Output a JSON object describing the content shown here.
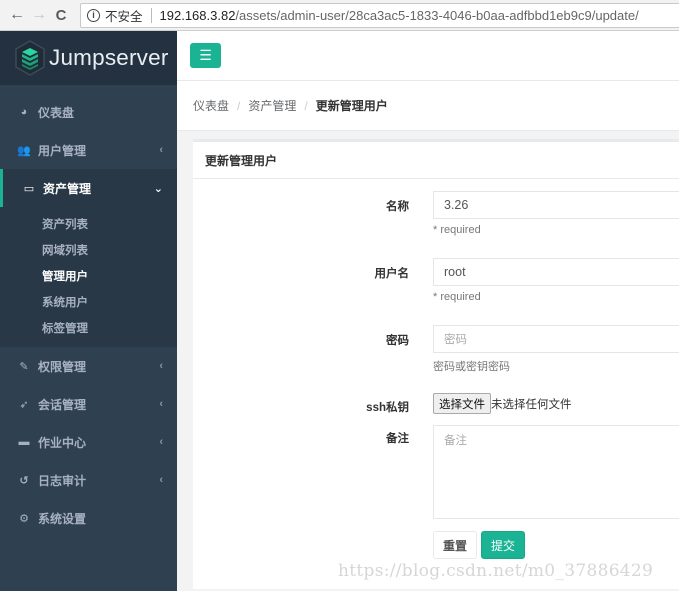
{
  "browser": {
    "back_icon": "arrow-left-icon",
    "forward_icon": "arrow-right-icon",
    "reload_icon": "reload-icon",
    "security_icon": "info-icon",
    "security_label": "不安全",
    "url_host": "192.168.3.82",
    "url_path": "/assets/admin-user/28ca3ac5-1833-4046-b0aa-adfbbd1eb9c9/update/"
  },
  "brand": {
    "name": "Jumpserver",
    "accent_color": "#1ab394",
    "sidebar_color": "#2f4050"
  },
  "sidebar": {
    "items": [
      {
        "label": "仪表盘",
        "icon": "dashboard-icon",
        "has_caret": false
      },
      {
        "label": "用户管理",
        "icon": "users-icon",
        "has_caret": true,
        "caret": "‹"
      },
      {
        "label": "资产管理",
        "icon": "inbox-icon",
        "has_caret": true,
        "caret": "⌄",
        "active": true,
        "children": [
          {
            "label": "资产列表"
          },
          {
            "label": "网域列表"
          },
          {
            "label": "管理用户",
            "active": true
          },
          {
            "label": "系统用户"
          },
          {
            "label": "标签管理"
          }
        ]
      },
      {
        "label": "权限管理",
        "icon": "edit-icon",
        "has_caret": true,
        "caret": "‹"
      },
      {
        "label": "会话管理",
        "icon": "rocket-icon",
        "has_caret": true,
        "caret": "‹"
      },
      {
        "label": "作业中心",
        "icon": "coffee-icon",
        "has_caret": true,
        "caret": "‹"
      },
      {
        "label": "日志审计",
        "icon": "history-icon",
        "has_caret": true,
        "caret": "‹"
      },
      {
        "label": "系统设置",
        "icon": "gears-icon",
        "has_caret": false
      }
    ]
  },
  "topbar": {
    "menu_toggle_icon": "hamburger-icon"
  },
  "breadcrumb": {
    "items": [
      "仪表盘",
      "资产管理",
      "更新管理用户"
    ],
    "separator": "/"
  },
  "form": {
    "title": "更新管理用户",
    "fields": {
      "name": {
        "label": "名称",
        "value": "3.26",
        "help": "* required"
      },
      "username": {
        "label": "用户名",
        "value": "root",
        "help": "* required"
      },
      "password": {
        "label": "密码",
        "placeholder": "密码",
        "help": "密码或密钥密码"
      },
      "ssh_key": {
        "label": "ssh私钥",
        "button_label": "选择文件",
        "status": "未选择任何文件"
      },
      "comment": {
        "label": "备注",
        "placeholder": "备注"
      }
    },
    "reset_label": "重置",
    "submit_label": "提交"
  },
  "watermark": "https://blog.csdn.net/m0_37886429"
}
